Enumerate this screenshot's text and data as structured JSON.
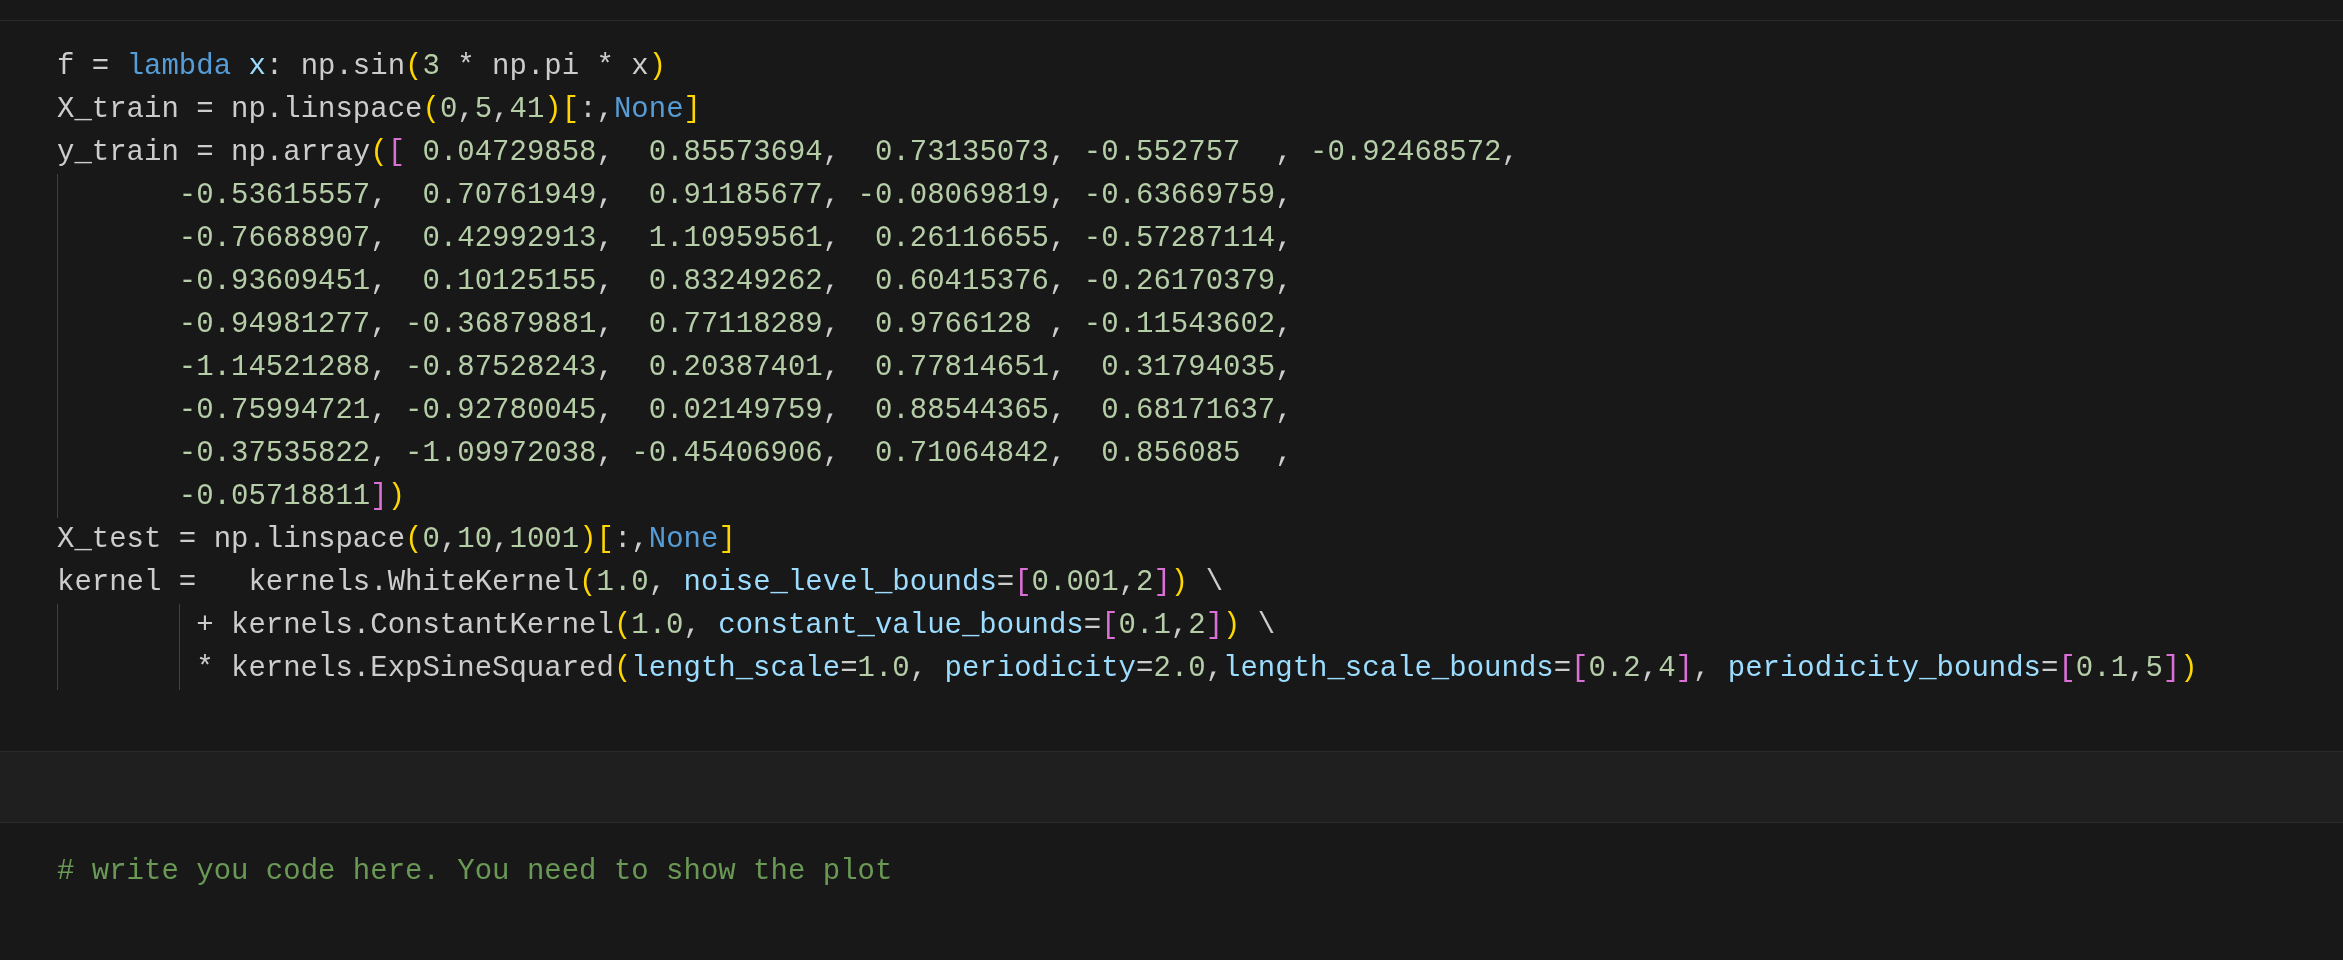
{
  "cells": [
    {
      "kind": "code",
      "lines": [
        {
          "tokens": [
            {
              "kind": "text",
              "text": "f = "
            },
            {
              "kind": "keyword",
              "text": "lambda"
            },
            {
              "kind": "param",
              "text": " x"
            },
            {
              "kind": "text",
              "text": ": np.sin"
            },
            {
              "kind": "bracket1",
              "text": "("
            },
            {
              "kind": "numbers",
              "text": "3"
            },
            {
              "kind": "text",
              "text": " * np.pi * x"
            },
            {
              "kind": "bracket1",
              "text": ")"
            }
          ]
        },
        {
          "tokens": [
            {
              "kind": "text",
              "text": "X_train = np.linspace"
            },
            {
              "kind": "bracket1",
              "text": "("
            },
            {
              "kind": "numbers",
              "text": "0,5,41"
            },
            {
              "kind": "bracket1",
              "text": ")"
            },
            {
              "kind": "bracket1",
              "text": "["
            },
            {
              "kind": "text",
              "text": ":,"
            },
            {
              "kind": "keyword",
              "text": "None"
            },
            {
              "kind": "bracket1",
              "text": "]"
            }
          ]
        },
        {
          "tokens": [
            {
              "kind": "text",
              "text": "y_train = np.array"
            },
            {
              "kind": "bracket1",
              "text": "("
            },
            {
              "kind": "bracket2",
              "text": "["
            },
            {
              "kind": "numbers",
              "text": " 0.04729858,  0.85573694,  0.73135073, -0.552757  , -0.92468572,"
            }
          ]
        },
        {
          "tokens": [
            {
              "kind": "indent"
            },
            {
              "kind": "numbers",
              "text": "-0.53615557,  0.70761949,  0.91185677, -0.08069819, -0.63669759,"
            }
          ]
        },
        {
          "tokens": [
            {
              "kind": "indent"
            },
            {
              "kind": "numbers",
              "text": "-0.76688907,  0.42992913,  1.10959561,  0.26116655, -0.57287114,"
            }
          ]
        },
        {
          "tokens": [
            {
              "kind": "indent"
            },
            {
              "kind": "numbers",
              "text": "-0.93609451,  0.10125155,  0.83249262,  0.60415376, -0.26170379,"
            }
          ]
        },
        {
          "tokens": [
            {
              "kind": "indent"
            },
            {
              "kind": "numbers",
              "text": "-0.94981277, -0.36879881,  0.77118289,  0.9766128 , -0.11543602,"
            }
          ]
        },
        {
          "tokens": [
            {
              "kind": "indent"
            },
            {
              "kind": "numbers",
              "text": "-1.14521288, -0.87528243,  0.20387401,  0.77814651,  0.31794035,"
            }
          ]
        },
        {
          "tokens": [
            {
              "kind": "indent"
            },
            {
              "kind": "numbers",
              "text": "-0.75994721, -0.92780045,  0.02149759,  0.88544365,  0.68171637,"
            }
          ]
        },
        {
          "tokens": [
            {
              "kind": "indent"
            },
            {
              "kind": "numbers",
              "text": "-0.37535822, -1.09972038, -0.45406906,  0.71064842,  0.856085  ,"
            }
          ]
        },
        {
          "tokens": [
            {
              "kind": "indent"
            },
            {
              "kind": "numbers",
              "text": "-0.05718811"
            },
            {
              "kind": "bracket2",
              "text": "]"
            },
            {
              "kind": "bracket1",
              "text": ")"
            }
          ]
        },
        {
          "tokens": [
            {
              "kind": "text",
              "text": "X_test = np.linspace"
            },
            {
              "kind": "bracket1",
              "text": "("
            },
            {
              "kind": "numbers",
              "text": "0,10,1001"
            },
            {
              "kind": "bracket1",
              "text": ")"
            },
            {
              "kind": "bracket1",
              "text": "["
            },
            {
              "kind": "text",
              "text": ":,"
            },
            {
              "kind": "keyword",
              "text": "None"
            },
            {
              "kind": "bracket1",
              "text": "]"
            }
          ]
        },
        {
          "tokens": [
            {
              "kind": "text",
              "text": "kernel =   kernels.WhiteKernel"
            },
            {
              "kind": "bracket1",
              "text": "("
            },
            {
              "kind": "numbers",
              "text": "1.0"
            },
            {
              "kind": "text",
              "text": ", "
            },
            {
              "kind": "param",
              "text": "noise_level_bounds"
            },
            {
              "kind": "text",
              "text": "="
            },
            {
              "kind": "bracket2",
              "text": "["
            },
            {
              "kind": "numbers",
              "text": "0.001,2"
            },
            {
              "kind": "bracket2",
              "text": "]"
            },
            {
              "kind": "bracket1",
              "text": ")"
            },
            {
              "kind": "text",
              "text": " \\"
            }
          ]
        },
        {
          "tokens": [
            {
              "kind": "indent"
            },
            {
              "kind": "indent_short"
            },
            {
              "kind": "text",
              "text": "+ kernels.ConstantKernel"
            },
            {
              "kind": "bracket1",
              "text": "("
            },
            {
              "kind": "numbers",
              "text": "1.0"
            },
            {
              "kind": "text",
              "text": ", "
            },
            {
              "kind": "param",
              "text": "constant_value_bounds"
            },
            {
              "kind": "text",
              "text": "="
            },
            {
              "kind": "bracket2",
              "text": "["
            },
            {
              "kind": "numbers",
              "text": "0.1,2"
            },
            {
              "kind": "bracket2",
              "text": "]"
            },
            {
              "kind": "bracket1",
              "text": ")"
            },
            {
              "kind": "text",
              "text": " \\"
            }
          ]
        },
        {
          "tokens": [
            {
              "kind": "indent"
            },
            {
              "kind": "indent_short"
            },
            {
              "kind": "text",
              "text": "* kernels.ExpSineSquared"
            },
            {
              "kind": "bracket1",
              "text": "("
            },
            {
              "kind": "param",
              "text": "length_scale"
            },
            {
              "kind": "text",
              "text": "="
            },
            {
              "kind": "numbers",
              "text": "1.0"
            },
            {
              "kind": "text",
              "text": ", "
            },
            {
              "kind": "param",
              "text": "periodicity"
            },
            {
              "kind": "text",
              "text": "="
            },
            {
              "kind": "numbers",
              "text": "2.0"
            },
            {
              "kind": "text",
              "text": ","
            },
            {
              "kind": "param",
              "text": "length_scale_bounds"
            },
            {
              "kind": "text",
              "text": "="
            },
            {
              "kind": "bracket2",
              "text": "["
            },
            {
              "kind": "numbers",
              "text": "0.2,4"
            },
            {
              "kind": "bracket2",
              "text": "]"
            },
            {
              "kind": "text",
              "text": ", "
            },
            {
              "kind": "param",
              "text": "periodicity_bounds"
            },
            {
              "kind": "text",
              "text": "="
            },
            {
              "kind": "bracket2",
              "text": "["
            },
            {
              "kind": "numbers",
              "text": "0.1,5"
            },
            {
              "kind": "bracket2",
              "text": "]"
            },
            {
              "kind": "bracket1",
              "text": ")"
            }
          ]
        }
      ]
    },
    {
      "kind": "code",
      "lines": [
        {
          "tokens": [
            {
              "kind": "comment",
              "text": "# write you code here. You need to show the plot"
            }
          ]
        }
      ]
    }
  ]
}
